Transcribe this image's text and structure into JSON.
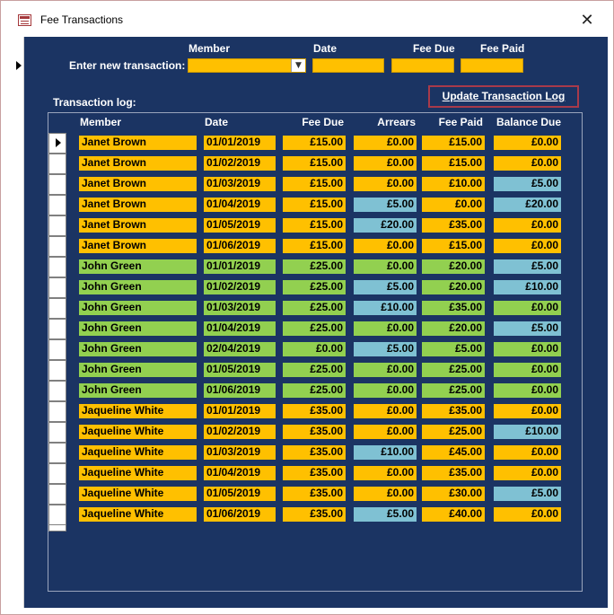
{
  "window": {
    "title": "Fee Transactions",
    "close_glyph": "✕"
  },
  "entry": {
    "label": "Enter new transaction:",
    "headers": {
      "member": "Member",
      "date": "Date",
      "fee_due": "Fee Due",
      "fee_paid": "Fee Paid"
    },
    "member_value": "",
    "date_value": "",
    "fee_due_value": "",
    "fee_paid_value": ""
  },
  "log": {
    "label": "Transaction log:",
    "update_button": "Update Transaction Log",
    "columns": [
      "Member",
      "Date",
      "Fee Due",
      "Arrears",
      "Fee Paid",
      "Balance Due"
    ],
    "rows": [
      {
        "member": "Janet Brown",
        "date": "01/01/2019",
        "fee_due": "£15.00",
        "arrears": "£0.00",
        "fee_paid": "£15.00",
        "balance_due": "£0.00",
        "person": "janet",
        "arrears_hl": false,
        "balance_hl": false
      },
      {
        "member": "Janet Brown",
        "date": "01/02/2019",
        "fee_due": "£15.00",
        "arrears": "£0.00",
        "fee_paid": "£15.00",
        "balance_due": "£0.00",
        "person": "janet",
        "arrears_hl": false,
        "balance_hl": false
      },
      {
        "member": "Janet Brown",
        "date": "01/03/2019",
        "fee_due": "£15.00",
        "arrears": "£0.00",
        "fee_paid": "£10.00",
        "balance_due": "£5.00",
        "person": "janet",
        "arrears_hl": false,
        "balance_hl": true
      },
      {
        "member": "Janet Brown",
        "date": "01/04/2019",
        "fee_due": "£15.00",
        "arrears": "£5.00",
        "fee_paid": "£0.00",
        "balance_due": "£20.00",
        "person": "janet",
        "arrears_hl": true,
        "balance_hl": true
      },
      {
        "member": "Janet Brown",
        "date": "01/05/2019",
        "fee_due": "£15.00",
        "arrears": "£20.00",
        "fee_paid": "£35.00",
        "balance_due": "£0.00",
        "person": "janet",
        "arrears_hl": true,
        "balance_hl": false
      },
      {
        "member": "Janet Brown",
        "date": "01/06/2019",
        "fee_due": "£15.00",
        "arrears": "£0.00",
        "fee_paid": "£15.00",
        "balance_due": "£0.00",
        "person": "janet",
        "arrears_hl": false,
        "balance_hl": false
      },
      {
        "member": "John Green",
        "date": "01/01/2019",
        "fee_due": "£25.00",
        "arrears": "£0.00",
        "fee_paid": "£20.00",
        "balance_due": "£5.00",
        "person": "john",
        "arrears_hl": false,
        "balance_hl": true
      },
      {
        "member": "John Green",
        "date": "01/02/2019",
        "fee_due": "£25.00",
        "arrears": "£5.00",
        "fee_paid": "£20.00",
        "balance_due": "£10.00",
        "person": "john",
        "arrears_hl": true,
        "balance_hl": true
      },
      {
        "member": "John Green",
        "date": "01/03/2019",
        "fee_due": "£25.00",
        "arrears": "£10.00",
        "fee_paid": "£35.00",
        "balance_due": "£0.00",
        "person": "john",
        "arrears_hl": true,
        "balance_hl": false
      },
      {
        "member": "John Green",
        "date": "01/04/2019",
        "fee_due": "£25.00",
        "arrears": "£0.00",
        "fee_paid": "£20.00",
        "balance_due": "£5.00",
        "person": "john",
        "arrears_hl": false,
        "balance_hl": true
      },
      {
        "member": "John Green",
        "date": "02/04/2019",
        "fee_due": "£0.00",
        "arrears": "£5.00",
        "fee_paid": "£5.00",
        "balance_due": "£0.00",
        "person": "john",
        "arrears_hl": true,
        "balance_hl": false
      },
      {
        "member": "John Green",
        "date": "01/05/2019",
        "fee_due": "£25.00",
        "arrears": "£0.00",
        "fee_paid": "£25.00",
        "balance_due": "£0.00",
        "person": "john",
        "arrears_hl": false,
        "balance_hl": false
      },
      {
        "member": "John Green",
        "date": "01/06/2019",
        "fee_due": "£25.00",
        "arrears": "£0.00",
        "fee_paid": "£25.00",
        "balance_due": "£0.00",
        "person": "john",
        "arrears_hl": false,
        "balance_hl": false
      },
      {
        "member": "Jaqueline White",
        "date": "01/01/2019",
        "fee_due": "£35.00",
        "arrears": "£0.00",
        "fee_paid": "£35.00",
        "balance_due": "£0.00",
        "person": "jaqueline",
        "arrears_hl": false,
        "balance_hl": false
      },
      {
        "member": "Jaqueline White",
        "date": "01/02/2019",
        "fee_due": "£35.00",
        "arrears": "£0.00",
        "fee_paid": "£25.00",
        "balance_due": "£10.00",
        "person": "jaqueline",
        "arrears_hl": false,
        "balance_hl": true
      },
      {
        "member": "Jaqueline White",
        "date": "01/03/2019",
        "fee_due": "£35.00",
        "arrears": "£10.00",
        "fee_paid": "£45.00",
        "balance_due": "£0.00",
        "person": "jaqueline",
        "arrears_hl": true,
        "balance_hl": false
      },
      {
        "member": "Jaqueline White",
        "date": "01/04/2019",
        "fee_due": "£35.00",
        "arrears": "£0.00",
        "fee_paid": "£35.00",
        "balance_due": "£0.00",
        "person": "jaqueline",
        "arrears_hl": false,
        "balance_hl": false
      },
      {
        "member": "Jaqueline White",
        "date": "01/05/2019",
        "fee_due": "£35.00",
        "arrears": "£0.00",
        "fee_paid": "£30.00",
        "balance_due": "£5.00",
        "person": "jaqueline",
        "arrears_hl": false,
        "balance_hl": true
      },
      {
        "member": "Jaqueline White",
        "date": "01/06/2019",
        "fee_due": "£35.00",
        "arrears": "£5.00",
        "fee_paid": "£40.00",
        "balance_due": "£0.00",
        "person": "jaqueline",
        "arrears_hl": true,
        "balance_hl": false
      }
    ]
  },
  "colors": {
    "form_background": "#1b3463",
    "orange": "#ffc000",
    "green": "#92d050",
    "blue_highlight": "#7fc1d3",
    "button_border": "#a83a4a"
  },
  "icons": {
    "app": "form-icon",
    "close": "close-icon",
    "dropdown": "chevron-down-icon",
    "record_pointer": "record-pointer-icon"
  }
}
